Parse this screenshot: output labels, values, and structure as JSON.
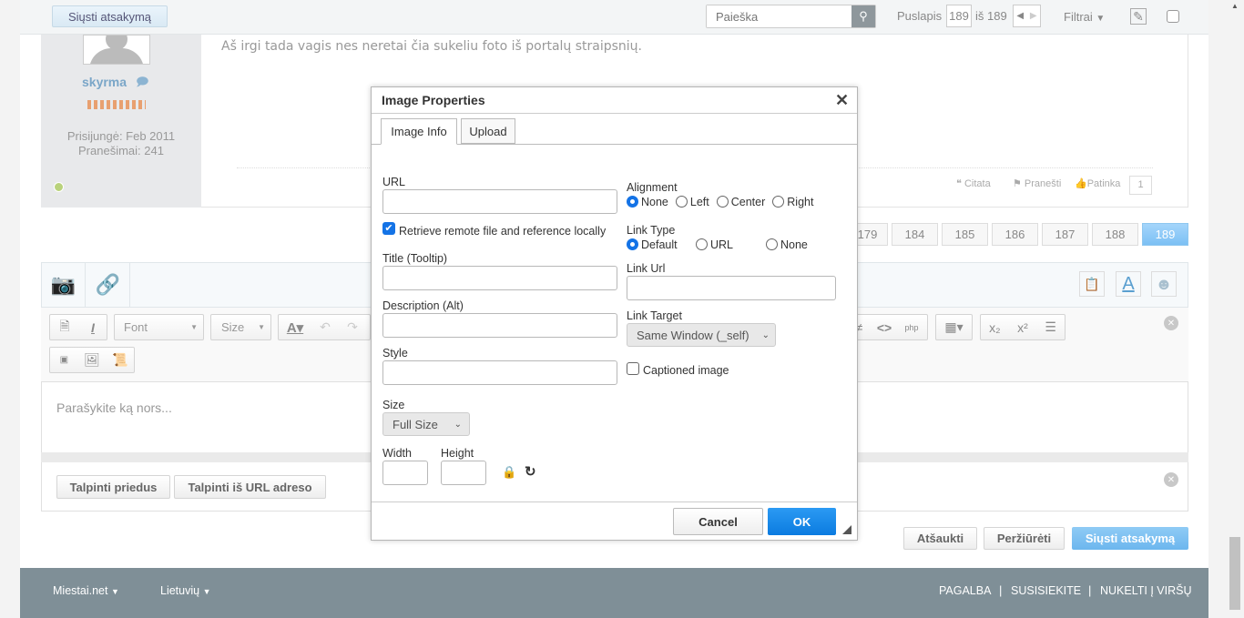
{
  "topbar": {
    "reply_button": "Siųsti atsakymą",
    "search_placeholder": "Paieška",
    "page_label": "Puslapis",
    "page_value": "189",
    "of_label": "iš 189",
    "filters_label": "Filtrai"
  },
  "post": {
    "username": "skyrma",
    "joined": "Prisijungė: Feb 2011",
    "posts": "Pranešimai: 241",
    "text": "Aš irgi tada vagis nes neretai čia sukeliu foto iš portalų straipsnių.",
    "quote": "Citata",
    "report": "Pranešti",
    "like": "Patinka",
    "like_count": "1"
  },
  "pagination": [
    "179",
    "184",
    "185",
    "186",
    "187",
    "188",
    "189"
  ],
  "editor": {
    "font_label": "Font",
    "size_label": "Size",
    "placeholder": "Parašykite ką nors...",
    "attach_button": "Talpinti priedus",
    "attach_url_button": "Talpinti iš URL adreso"
  },
  "actions": {
    "cancel": "Atšaukti",
    "preview": "Peržiūrėti",
    "submit": "Siųsti atsakymą"
  },
  "footer": {
    "site": "Miestai.net",
    "language": "Lietuvių",
    "help": "PAGALBA",
    "contact": "SUSISIEKITE",
    "top": "NUKELTI Į VIRŠŲ"
  },
  "dialog": {
    "title": "Image Properties",
    "tabs": [
      "Image Info",
      "Upload"
    ],
    "url_label": "URL",
    "url_value": "",
    "retrieve_label": "Retrieve remote file and reference locally",
    "retrieve_checked": true,
    "title_label": "Title (Tooltip)",
    "desc_label": "Description (Alt)",
    "style_label": "Style",
    "size_label": "Size",
    "size_value": "Full Size",
    "width_label": "Width",
    "height_label": "Height",
    "alignment_label": "Alignment",
    "alignment_options": [
      "None",
      "Left",
      "Center",
      "Right"
    ],
    "alignment_selected": "None",
    "linktype_label": "Link Type",
    "linktype_options": [
      "Default",
      "URL",
      "None"
    ],
    "linktype_selected": "Default",
    "linkurl_label": "Link Url",
    "linktarget_label": "Link Target",
    "linktarget_value": "Same Window (_self)",
    "captioned_label": "Captioned image",
    "captioned_checked": false,
    "cancel": "Cancel",
    "ok": "OK"
  },
  "colors": {
    "accent": "#1a8cf0",
    "footer": "#7f8f97",
    "username": "#7aa6c8"
  }
}
